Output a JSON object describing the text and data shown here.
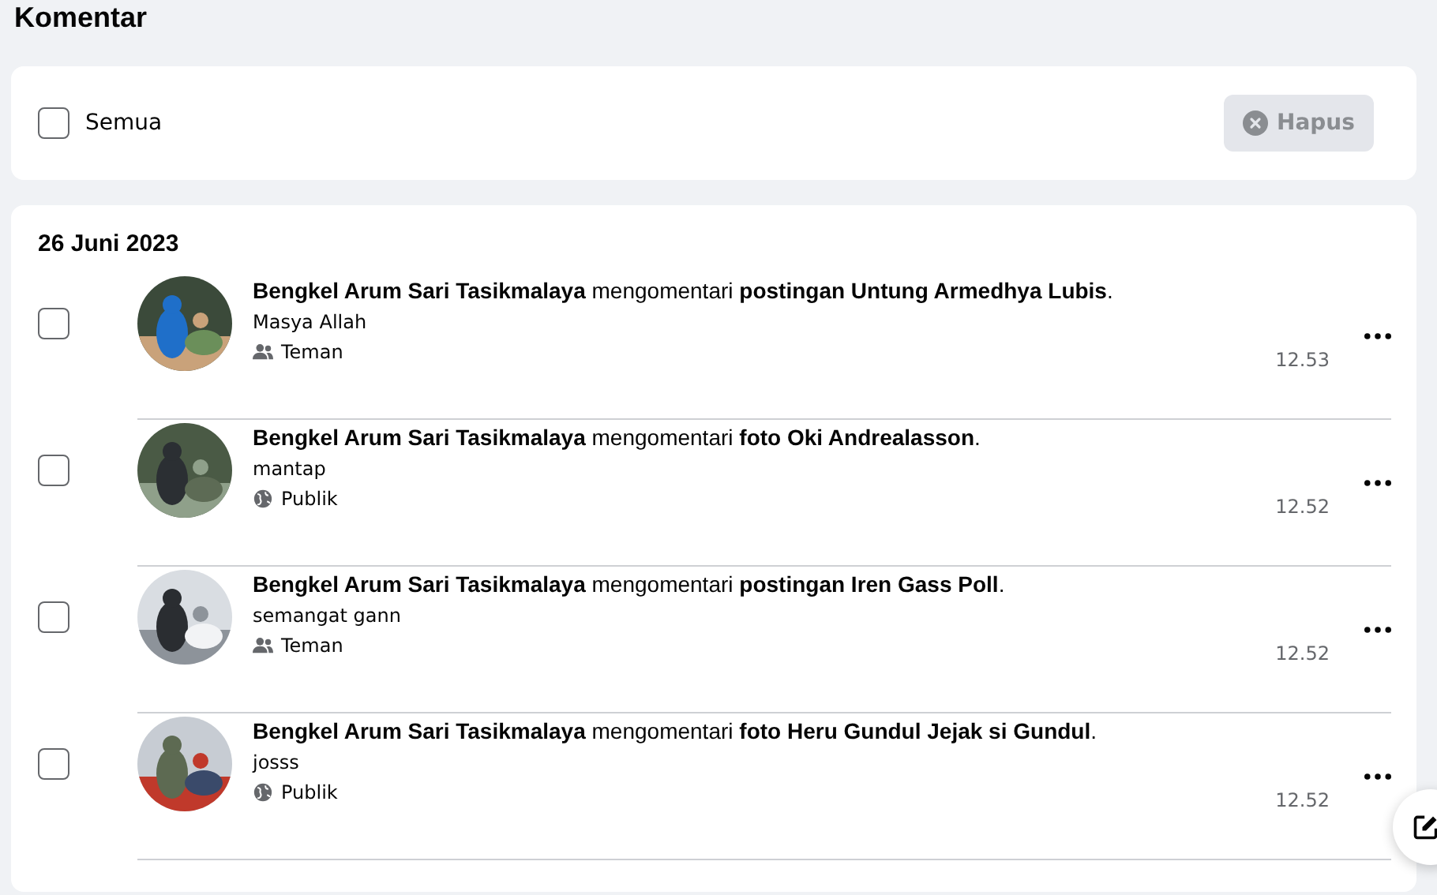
{
  "title": "Komentar",
  "toolbar": {
    "select_all": {
      "label": "Semua",
      "checked": false
    },
    "delete_button": {
      "label": "Hapus",
      "disabled": true
    }
  },
  "groups": [
    {
      "date": "26 Juni 2023",
      "items": [
        {
          "checked": false,
          "text": "**Bengkel Arum Sari Tasikmalaya** mengomentari **postingan Untung Armedhya Lubis**.",
          "comment": "Masya Allah",
          "audience": {
            "kind": "friends",
            "label": "Teman"
          },
          "time": "12.53"
        },
        {
          "checked": false,
          "text": "**Bengkel Arum Sari Tasikmalaya** mengomentari **foto Oki Andrealasson**.",
          "comment": "mantap",
          "audience": {
            "kind": "public",
            "label": "Publik"
          },
          "time": "12.52"
        },
        {
          "checked": false,
          "text": "**Bengkel Arum Sari Tasikmalaya** mengomentari **postingan Iren Gass Poll**.",
          "comment": "semangat gann",
          "audience": {
            "kind": "friends",
            "label": "Teman"
          },
          "time": "12.52"
        },
        {
          "checked": false,
          "text": "**Bengkel Arum Sari Tasikmalaya** mengomentari **foto Heru Gundul Jejak si Gundul**.",
          "comment": "josss",
          "audience": {
            "kind": "public",
            "label": "Publik"
          },
          "time": "12.52"
        }
      ]
    }
  ]
}
